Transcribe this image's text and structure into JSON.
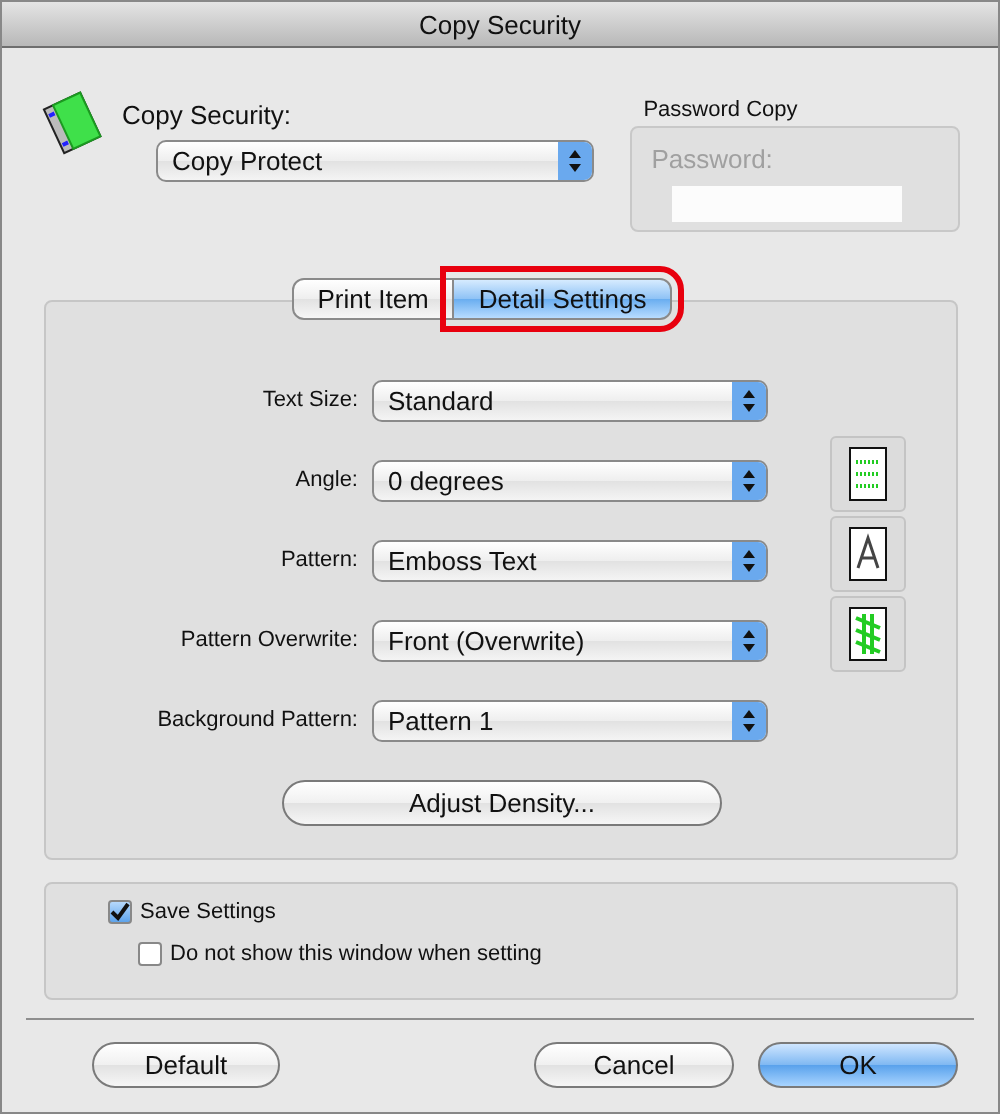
{
  "window": {
    "title": "Copy Security"
  },
  "copy_security": {
    "label": "Copy Security:",
    "value": "Copy Protect"
  },
  "password_copy": {
    "title": "Password Copy",
    "label": "Password:",
    "disabled": true
  },
  "tabs": [
    {
      "label": "Print Item",
      "selected": false,
      "highlighted": false
    },
    {
      "label": "Detail Settings",
      "selected": true,
      "highlighted": true
    }
  ],
  "settings": [
    {
      "label": "Text Size:",
      "value": "Standard"
    },
    {
      "label": "Angle:",
      "value": "0 degrees"
    },
    {
      "label": "Pattern:",
      "value": "Emboss Text"
    },
    {
      "label": "Pattern Overwrite:",
      "value": "Front (Overwrite)"
    },
    {
      "label": "Background Pattern:",
      "value": "Pattern 1"
    }
  ],
  "adjust_button": "Adjust Density...",
  "options": [
    {
      "label": "Save Settings",
      "checked": true,
      "children": [
        {
          "label": "Do not show this window when setting",
          "checked": false
        }
      ]
    }
  ],
  "buttons": [
    {
      "label": "Default",
      "default": false
    },
    {
      "label": "Cancel",
      "default": false
    },
    {
      "label": "OK",
      "default": true
    }
  ]
}
